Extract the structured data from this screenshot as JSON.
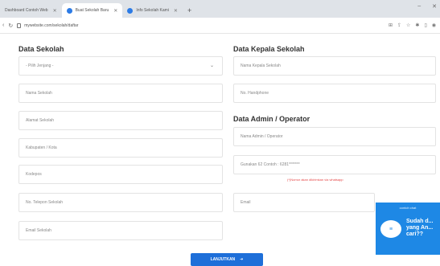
{
  "browser": {
    "tabs": [
      {
        "label": "Dashboard Contoh Web",
        "active": false
      },
      {
        "label": "Buat Sekolah Baru",
        "active": true
      },
      {
        "label": "Info Sekolah Kami",
        "active": false
      }
    ],
    "new_tab": "+",
    "url": "mywebsite.com/sekolah/daftar"
  },
  "sekolah": {
    "title": "Data Sekolah",
    "jenjang_placeholder": "- Pilih Jenjang -",
    "nama_placeholder": "Nama Sekolah",
    "alamat_placeholder": "Alamat Sekolah",
    "kabupaten_placeholder": "Kabupaten / Kota",
    "kodepos_placeholder": "Kodepos",
    "telepon_placeholder": "No. Telepon Sekolah",
    "email_placeholder": "Email Sekolah"
  },
  "kepala": {
    "title": "Data Kepala Sekolah",
    "nama_placeholder": "Nama Kepala Sekolah",
    "hp_placeholder": "No. Handphone"
  },
  "admin": {
    "title": "Data Admin / Operator",
    "nama_placeholder": "Nama Admin / Operator",
    "hp_placeholder": "Gunakan 62 Contoh : 6281*******",
    "hp_hint": "(*)Nomor akan dikirimkan via whatsapp",
    "email_placeholder": "Email"
  },
  "actions": {
    "submit_label": "LANJUTKAN",
    "submit_icon": "arrow-right-icon"
  },
  "chat": {
    "header": "contoh chat",
    "message": "Sudah d... yang An... cari??",
    "colors": {
      "accent": "#1e88e5"
    }
  }
}
